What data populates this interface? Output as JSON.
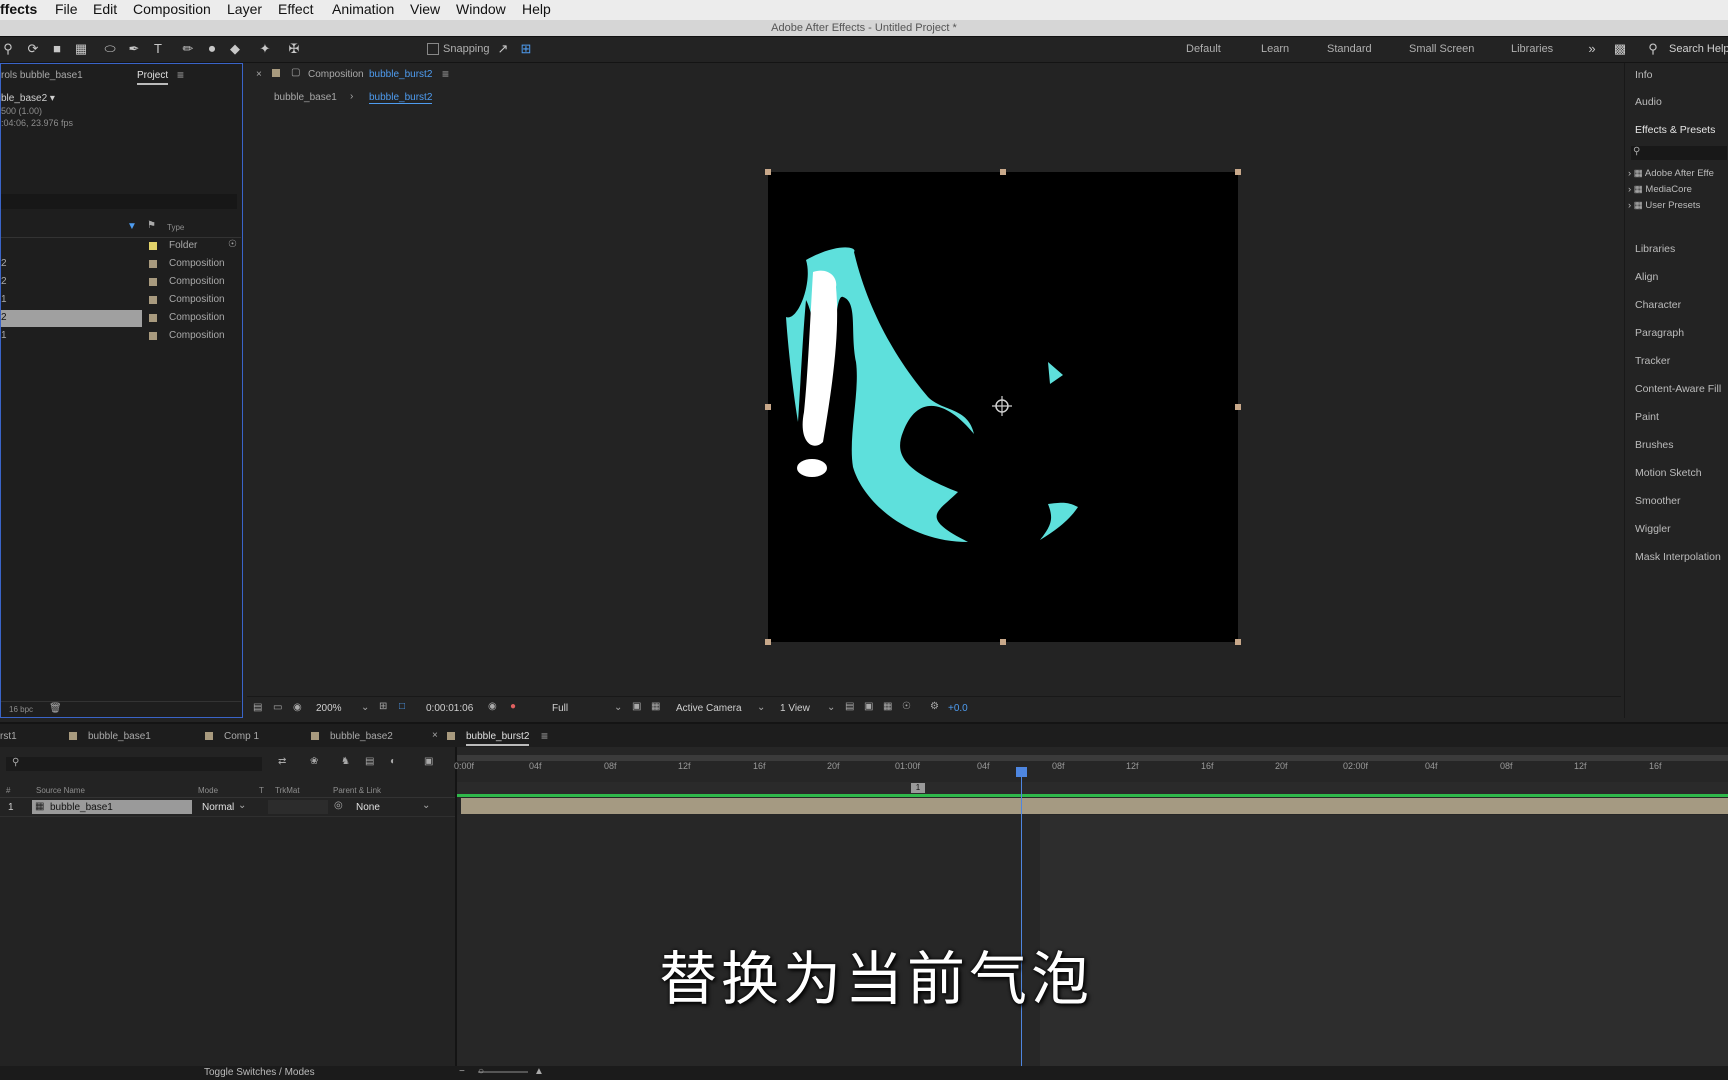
{
  "menubar": {
    "app": "ffects",
    "items": [
      "File",
      "Edit",
      "Composition",
      "Layer",
      "Effect",
      "Animation",
      "View",
      "Window",
      "Help"
    ]
  },
  "window_title": "Adobe After Effects - Untitled Project *",
  "toolbar": {
    "snapping_label": "Snapping",
    "workspaces": [
      "Default",
      "Learn",
      "Standard",
      "Small Screen",
      "Libraries"
    ],
    "search_help": "Search Help"
  },
  "project_panel": {
    "tab_controls": "rols bubble_base1",
    "tab_project": "Project",
    "item_name": "ble_base2 ▾",
    "item_info_1": "500 (1.00)",
    "item_info_2": ":04:06, 23.976 fps",
    "type_header": "Type",
    "rows": [
      {
        "name": "",
        "type": "Folder",
        "color": "#e2d36a"
      },
      {
        "name": "2",
        "type": "Composition",
        "color": "#a89a7e"
      },
      {
        "name": "2",
        "type": "Composition",
        "color": "#a89a7e"
      },
      {
        "name": "1",
        "type": "Composition",
        "color": "#a89a7e"
      },
      {
        "name": "2",
        "type": "Composition",
        "color": "#a89a7e"
      },
      {
        "name": "1",
        "type": "Composition",
        "color": "#a89a7e"
      }
    ],
    "bpc": "16 bpc"
  },
  "comp_panel": {
    "tab_prefix": "Composition",
    "tab_name": "bubble_burst2",
    "breadcrumb_1": "bubble_base1",
    "breadcrumb_2": "bubble_burst2",
    "zoom": "200%",
    "timecode": "0:00:01:06",
    "resolution": "Full",
    "camera": "Active Camera",
    "views": "1 View",
    "exposure": "+0.0"
  },
  "right_panel": {
    "items": [
      "Info",
      "Audio",
      "Effects & Presets",
      "Libraries",
      "Align",
      "Character",
      "Paragraph",
      "Tracker",
      "Content-Aware Fill",
      "Paint",
      "Brushes",
      "Motion Sketch",
      "Smoother",
      "Wiggler",
      "Mask Interpolation"
    ],
    "presets": [
      "Adobe After Effe",
      "MediaCore",
      "User Presets"
    ]
  },
  "timeline": {
    "tabs": [
      "rst1",
      "bubble_base1",
      "Comp 1",
      "bubble_base2",
      "bubble_burst2"
    ],
    "headers": {
      "num": "#",
      "source": "Source Name",
      "mode": "Mode",
      "t": "T",
      "trkmat": "TrkMat",
      "parent": "Parent & Link"
    },
    "layer": {
      "num": "1",
      "name": "bubble_base1",
      "mode": "Normal",
      "parent": "None"
    },
    "ticks": [
      "0:00f",
      "04f",
      "08f",
      "12f",
      "16f",
      "20f",
      "01:00f",
      "04f",
      "08f",
      "12f",
      "16f",
      "20f",
      "02:00f",
      "04f",
      "08f",
      "12f",
      "16f"
    ],
    "marker": "1",
    "toggle": "Toggle Switches / Modes"
  },
  "subtitle": "替换为当前气泡"
}
